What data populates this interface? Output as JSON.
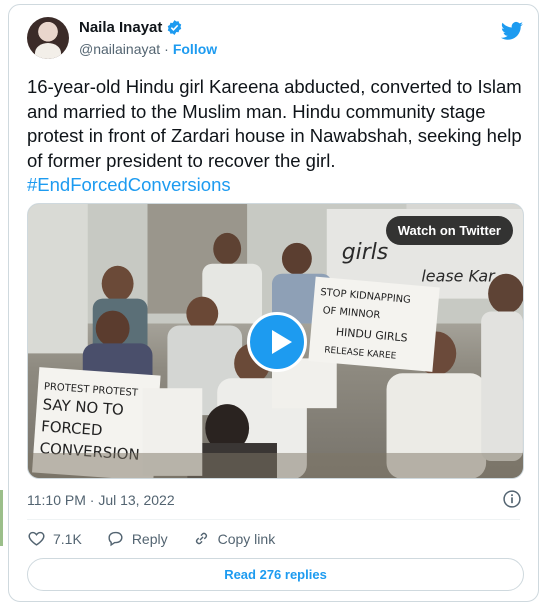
{
  "author": {
    "name": "Naila Inayat",
    "handle": "@nailainayat",
    "separator": "·",
    "follow_label": "Follow"
  },
  "tweet": {
    "text": "16-year-old Hindu girl Kareena abducted, converted to Islam and married to the Muslim man. Hindu community stage protest in front of Zardari house in Nawabshah, seeking help of former president to recover the girl.",
    "hashtag": "#EndForcedConversions"
  },
  "media": {
    "watch_label": "Watch on Twitter",
    "signs": {
      "left": [
        "PROTEST PROTEST",
        "SAY NO TO",
        "FORCED",
        "CONVERSION"
      ],
      "right": [
        "STOP KIDNAPPING",
        "OF MINNOR",
        "HINDU GIRLS",
        "RELEASE KAREE"
      ],
      "back": [
        "girls",
        "lease Kar"
      ]
    }
  },
  "meta": {
    "timestamp": "11:10 PM · Jul 13, 2022"
  },
  "actions": {
    "likes": "7.1K",
    "reply_label": "Reply",
    "copy_label": "Copy link"
  },
  "replies_button": "Read 276 replies",
  "colors": {
    "accent": "#1d9bf0",
    "text": "#0f1419",
    "muted": "#536471",
    "border": "#cfd9de"
  }
}
